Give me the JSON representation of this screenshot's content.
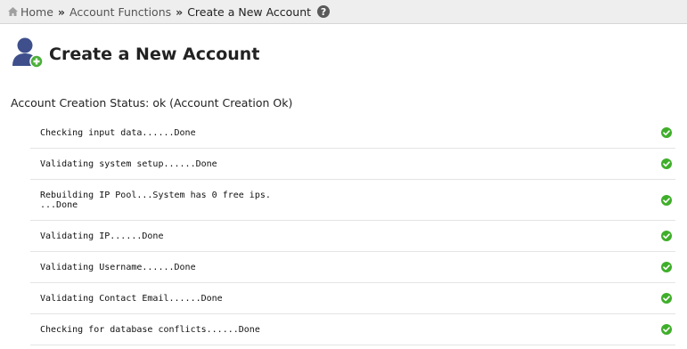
{
  "breadcrumb": {
    "home": "Home",
    "separator": "»",
    "section": "Account Functions",
    "current": "Create a New Account",
    "help_glyph": "?"
  },
  "page": {
    "title": "Create a New Account",
    "icon": "user-add-icon"
  },
  "status": {
    "text": "Account Creation Status: ok (Account Creation Ok)"
  },
  "steps": [
    {
      "text": "Checking input data......Done",
      "status": "ok"
    },
    {
      "text": "Validating system setup......Done",
      "status": "ok"
    },
    {
      "text": "Rebuilding IP Pool...System has 0 free ips.\n...Done",
      "status": "ok"
    },
    {
      "text": "Validating IP......Done",
      "status": "ok"
    },
    {
      "text": "Validating Username......Done",
      "status": "ok"
    },
    {
      "text": "Validating Contact Email......Done",
      "status": "ok"
    },
    {
      "text": "Checking for database conflicts......Done",
      "status": "ok"
    }
  ],
  "colors": {
    "check": "#3fae2a",
    "user_icon": "#3e4f8c",
    "add_badge": "#4caf3a"
  }
}
